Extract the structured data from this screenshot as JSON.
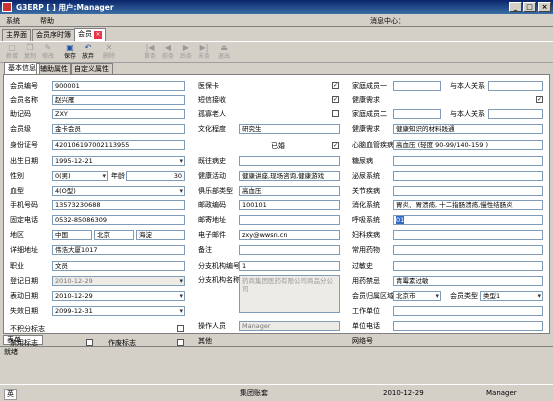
{
  "window": {
    "title": "G3ERP [ ] 用户:Manager",
    "minimize": "_",
    "restore": "□",
    "close": "×"
  },
  "menu": {
    "system": "系统",
    "help": "帮助",
    "message_center": "消息中心："
  },
  "tabs": [
    "主界面",
    "会员序时簿",
    "会员"
  ],
  "toolbar": [
    {
      "label": "新增",
      "icon": "new-icon",
      "enabled": false
    },
    {
      "label": "复制",
      "icon": "copy-icon",
      "enabled": false
    },
    {
      "label": "修改",
      "icon": "edit-icon",
      "enabled": false
    },
    {
      "label": "保存",
      "icon": "save-icon",
      "enabled": true
    },
    {
      "label": "放弃",
      "icon": "undo-icon",
      "enabled": true
    },
    {
      "label": "删除",
      "icon": "delete-icon",
      "enabled": false
    },
    {
      "label": "首条",
      "icon": "first-icon",
      "enabled": false
    },
    {
      "label": "前条",
      "icon": "prev-icon",
      "enabled": false
    },
    {
      "label": "后条",
      "icon": "next-icon",
      "enabled": false
    },
    {
      "label": "末条",
      "icon": "last-icon",
      "enabled": false
    },
    {
      "label": "退出",
      "icon": "exit-icon",
      "enabled": false
    }
  ],
  "subtabs": [
    "基本信息",
    "辅助属性",
    "自定义属性"
  ],
  "form": {
    "member_no": {
      "label": "会员编号",
      "value": "900001"
    },
    "member_name": {
      "label": "会员名称",
      "value": "赵兴雁"
    },
    "mnemonic": {
      "label": "助记码",
      "value": "ZXY"
    },
    "member_level": {
      "label": "会员级",
      "value": "金卡会员"
    },
    "id_number": {
      "label": "身份证号",
      "value": "420106197002113955"
    },
    "birth_date": {
      "label": "出生日期",
      "value": "1995-12-21"
    },
    "gender": {
      "label": "性别",
      "value": "0(男)"
    },
    "age": {
      "label": "年龄",
      "value": "30"
    },
    "blood_type": {
      "label": "血型",
      "value": "4(O型)"
    },
    "mobile": {
      "label": "手机号码",
      "value": "13573230688"
    },
    "landline": {
      "label": "固定电话",
      "value": "0532-85086309"
    },
    "region": {
      "label": "地区",
      "country": "中国",
      "city": "北京",
      "district": "海淀"
    },
    "address": {
      "label": "详细地址",
      "value": "伟浩大厦1017"
    },
    "occupation": {
      "label": "职业",
      "value": "文员"
    },
    "register_date": {
      "label": "登记日期",
      "value": "2010-12-29"
    },
    "effective_date": {
      "label": "表动日期",
      "value": "2010-12-29"
    },
    "expire_date": {
      "label": "失效日期",
      "value": "2099-12-31"
    },
    "no_points": {
      "label": "不积分标志",
      "checked": false
    },
    "disabled": {
      "label": "禁用标志",
      "checked": false
    },
    "voided": {
      "label": "作废标志",
      "checked": false
    },
    "medical_card": {
      "label": "医保卡",
      "checked": true
    },
    "sms": {
      "label": "短信接收",
      "checked": true
    },
    "elderly": {
      "label": "孤寡老人",
      "checked": false
    },
    "education": {
      "label": "文化程度",
      "value": "研究生"
    },
    "married": {
      "label": "已婚",
      "checked": true
    },
    "past_history": {
      "label": "既往病史",
      "value": ""
    },
    "health_activity": {
      "label": "健康活动",
      "value": "健康讲座,现场咨询,健康游戏"
    },
    "club_type": {
      "label": "俱乐部类型",
      "value": "高血压"
    },
    "postal_code": {
      "label": "邮政编码",
      "value": "100101"
    },
    "post_address": {
      "label": "邮寄地址",
      "value": ""
    },
    "email": {
      "label": "电子邮件",
      "value": "zxy@wwsn.cn"
    },
    "remark": {
      "label": "备注",
      "value": ""
    },
    "branch_code": {
      "label": "分支机构编号",
      "value": "1"
    },
    "branch_name": {
      "label": "分支机构名称",
      "value": "药商集团医药有限公司商品分公司"
    },
    "operator": {
      "label": "操作人员",
      "value": "Manager"
    },
    "other": {
      "label": "其他",
      "value": ""
    },
    "family_one": {
      "label": "家庭成员一",
      "value": "",
      "rel_label": "与本人关系",
      "rel_value": ""
    },
    "health_need1": {
      "label": "健康需求",
      "checked": true
    },
    "family_two": {
      "label": "家庭成员二",
      "value": "",
      "rel_label": "与本人关系",
      "rel_value": ""
    },
    "health_need2": {
      "label": "健康需求",
      "value": "健康知识的材料践通"
    },
    "cardio": {
      "label": "心脑血管疾病",
      "value": "高血压 (轻度 90-99/140-159 )"
    },
    "diabetes": {
      "label": "糖尿病",
      "value": ""
    },
    "urology": {
      "label": "泌尿系统",
      "value": ""
    },
    "joint": {
      "label": "关节疾病",
      "value": ""
    },
    "digestive": {
      "label": "消化系统",
      "value": "胃炎、胃溃疡, 十二指肠溃疡,慢性结肠炎"
    },
    "respiratory": {
      "label": "呼吸系统",
      "value": "01"
    },
    "gynecology": {
      "label": "妇科疾病",
      "value": ""
    },
    "common_drugs": {
      "label": "常用药物",
      "value": ""
    },
    "allergy": {
      "label": "过敏史",
      "value": ""
    },
    "contraindication": {
      "label": "用药禁忌",
      "value": "青霉素过敏"
    },
    "member_area": {
      "label": "会员归属区域",
      "value": "北京市"
    },
    "member_type": {
      "label": "会员类型",
      "value": "类型1"
    },
    "work_unit": {
      "label": "工作单位",
      "value": ""
    },
    "unit_phone": {
      "label": "单位电话",
      "value": ""
    },
    "website": {
      "label": "网络号",
      "value": ""
    }
  },
  "bottom": {
    "list_tab": "表单",
    "status": "就绪",
    "company": "集团账套",
    "date": "2010-12-29",
    "user": "Manager",
    "taskbar": "英"
  }
}
